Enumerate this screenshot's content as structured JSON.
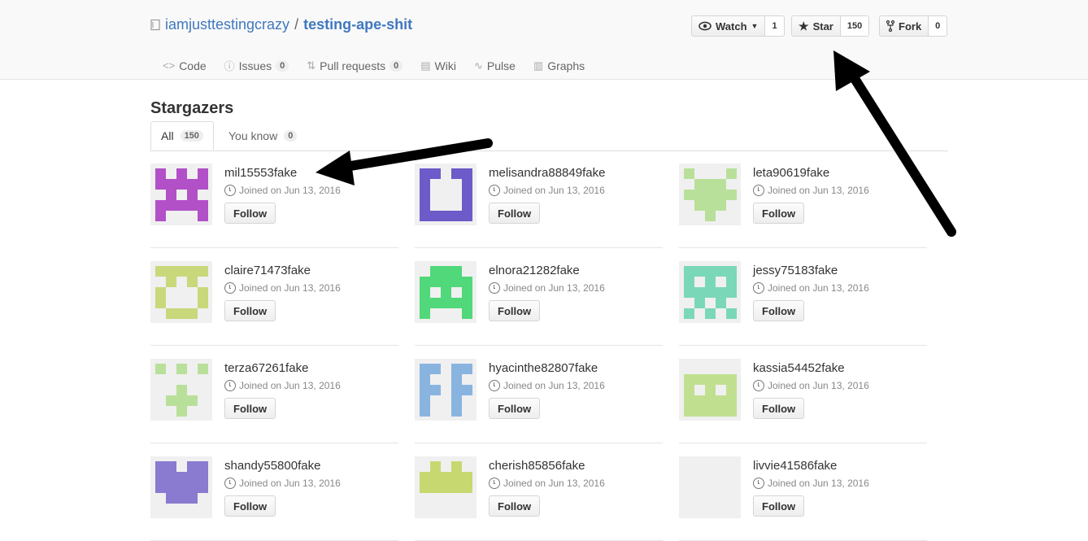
{
  "repo": {
    "owner": "iamjusttestingcrazy",
    "separator": "/",
    "name": "testing-ape-shit"
  },
  "actions": {
    "watch": {
      "label": "Watch",
      "count": "1"
    },
    "star": {
      "label": "Star",
      "count": "150"
    },
    "fork": {
      "label": "Fork",
      "count": "0"
    }
  },
  "nav": [
    {
      "label": "Code",
      "icon": "code-icon"
    },
    {
      "label": "Issues",
      "count": "0",
      "icon": "issue-icon"
    },
    {
      "label": "Pull requests",
      "count": "0",
      "icon": "pull-request-icon"
    },
    {
      "label": "Wiki",
      "icon": "wiki-icon"
    },
    {
      "label": "Pulse",
      "icon": "pulse-icon"
    },
    {
      "label": "Graphs",
      "icon": "graph-icon"
    }
  ],
  "page_title": "Stargazers",
  "tabs": [
    {
      "label": "All",
      "count": "150"
    },
    {
      "label": "You know",
      "count": "0"
    }
  ],
  "users": [
    {
      "name": "mil15553fake",
      "joined": "Joined on Jun 13, 2016",
      "follow": "Follow",
      "color": "#b250c8"
    },
    {
      "name": "melisandra88849fake",
      "joined": "Joined on Jun 13, 2016",
      "follow": "Follow",
      "color": "#6c5bc8"
    },
    {
      "name": "leta90619fake",
      "joined": "Joined on Jun 13, 2016",
      "follow": "Follow",
      "color": "#b9e09a"
    },
    {
      "name": "claire71473fake",
      "joined": "Joined on Jun 13, 2016",
      "follow": "Follow",
      "color": "#c8d87a"
    },
    {
      "name": "elnora21282fake",
      "joined": "Joined on Jun 13, 2016",
      "follow": "Follow",
      "color": "#50d87a"
    },
    {
      "name": "jessy75183fake",
      "joined": "Joined on Jun 13, 2016",
      "follow": "Follow",
      "color": "#7ad8b9"
    },
    {
      "name": "terza67261fake",
      "joined": "Joined on Jun 13, 2016",
      "follow": "Follow",
      "color": "#b9e09a"
    },
    {
      "name": "hyacinthe82807fake",
      "joined": "Joined on Jun 13, 2016",
      "follow": "Follow",
      "color": "#8ab4e0"
    },
    {
      "name": "kassia54452fake",
      "joined": "Joined on Jun 13, 2016",
      "follow": "Follow",
      "color": "#c0e090"
    },
    {
      "name": "shandy55800fake",
      "joined": "Joined on Jun 13, 2016",
      "follow": "Follow",
      "color": "#8a7ad0"
    },
    {
      "name": "cherish85856fake",
      "joined": "Joined on Jun 13, 2016",
      "follow": "Follow",
      "color": "#c8d870"
    },
    {
      "name": "livvie41586fake",
      "joined": "Joined on Jun 13, 2016",
      "follow": "Follow",
      "color": "#dddddd"
    }
  ]
}
